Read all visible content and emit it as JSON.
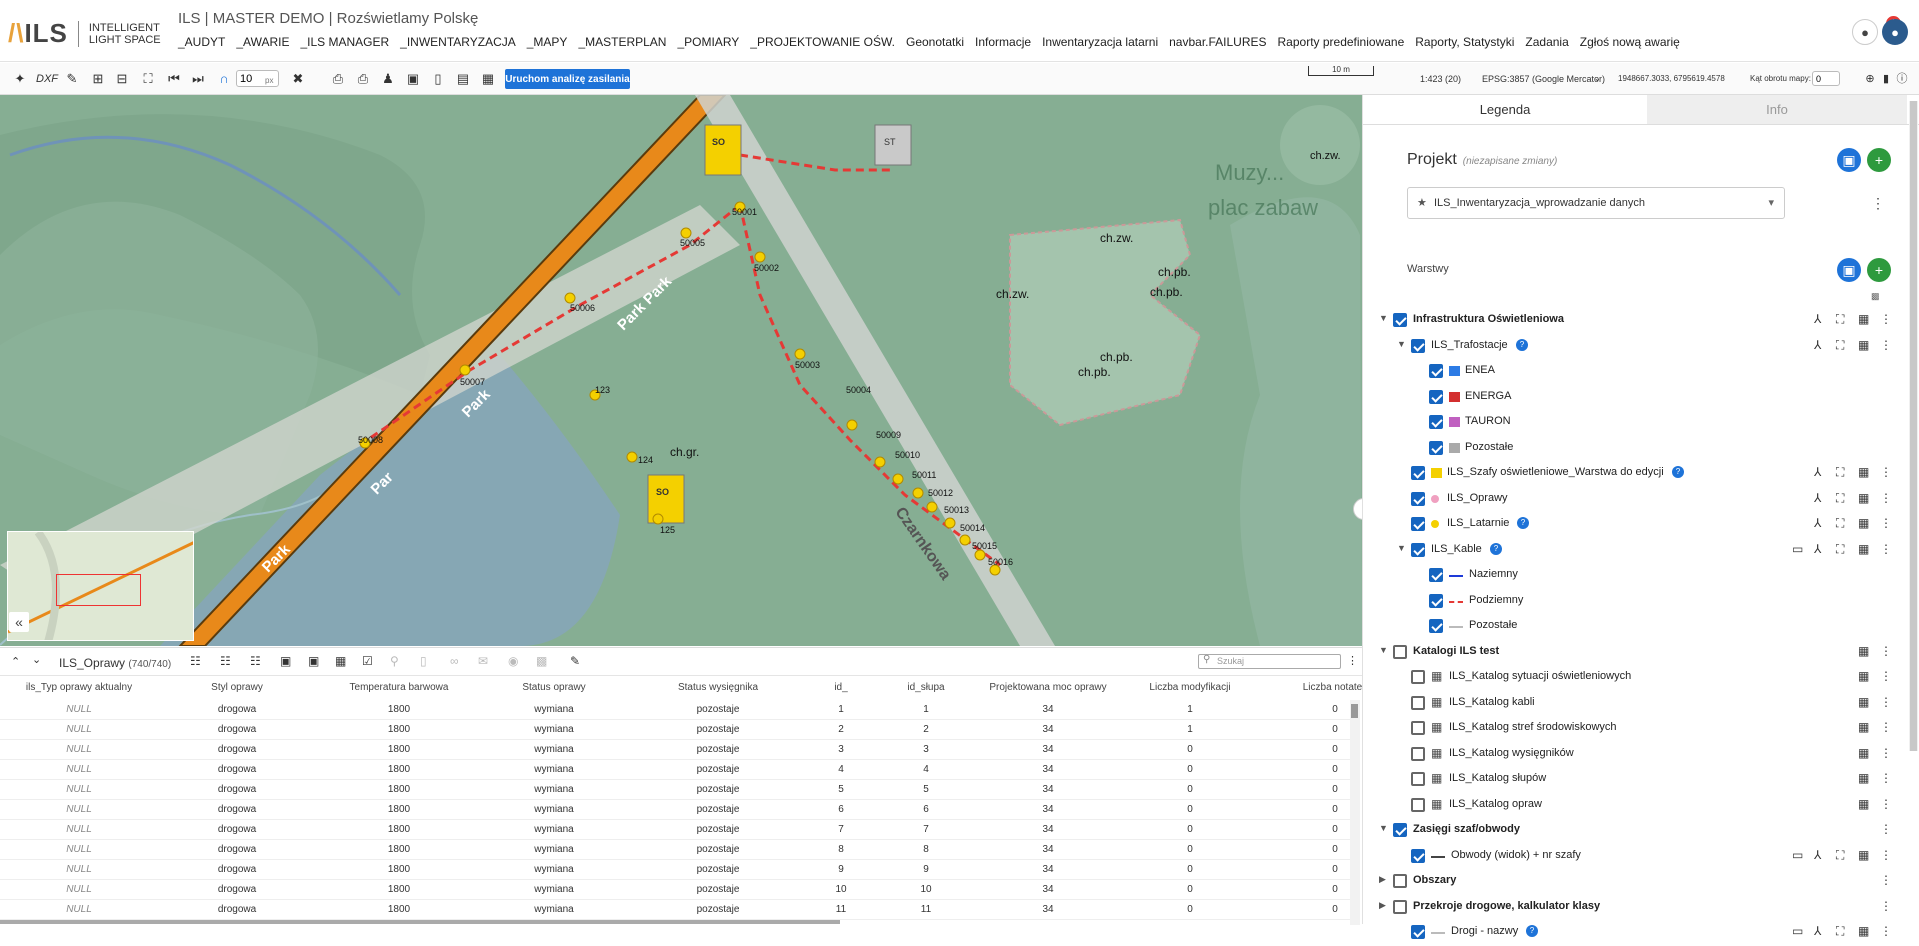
{
  "app": {
    "logo_mark": "ILS",
    "logo_text_1": "INTELLIGENT",
    "logo_text_2": "LIGHT SPACE",
    "title": "ILS | MASTER DEMO | Rozświetlamy Polskę",
    "notification_count": "1"
  },
  "menu": [
    "_AUDYT",
    "_AWARIE",
    "_ILS MANAGER",
    "_INWENTARYZACJA",
    "_MAPY",
    "_MASTERPLAN",
    "_POMIARY",
    "_PROJEKTOWANIE OŚW.",
    "Geonotatki",
    "Informacje",
    "Inwentaryzacja latarni",
    "navbar.FAILURES",
    "Raporty predefiniowane",
    "Raporty, Statystyki",
    "Zadania",
    "Zgłoś nową awarię"
  ],
  "toolbar": {
    "dxf_label": "DXF",
    "tolerance_value": "10",
    "tolerance_unit": "px",
    "run_button": "Uruchom analizę zasilania",
    "scale_bar_label": "10 m",
    "scale": "1:423 (20)",
    "crs": "EPSG:3857 (Google Mercator)",
    "coords": "1948667.3033, 6795619.4578",
    "rotation_label": "Kąt obrotu mapy:",
    "rotation_value": "0"
  },
  "map": {
    "labels": {
      "park1": "Park",
      "park2": "Park Park",
      "park3": "Park",
      "park4": "Par",
      "street": "Czarnkowa",
      "playground1": "Muzy...",
      "playground2": "plac zabaw",
      "chgr": "ch.gr.",
      "chzw1": "ch.zw.",
      "chzw2": "ch.zw.",
      "chzw3": "ch.zw.",
      "chpb1": "ch.pb.",
      "chpb2": "ch.pb.",
      "chpb3": "ch.pb.",
      "chpb4": "ch.pb.",
      "so_label": "SO",
      "st_label": "ST"
    },
    "points": [
      "50001",
      "50002",
      "50003",
      "50004",
      "50005",
      "50006",
      "50007",
      "50008",
      "50009",
      "50010",
      "50011",
      "50012",
      "50013",
      "50014",
      "50015",
      "50016",
      "123",
      "124",
      "125"
    ]
  },
  "table": {
    "layer_name": "ILS_Oprawy",
    "count": "(740/740)",
    "search_placeholder": "Szukaj",
    "columns": [
      "ils_Typ oprawy aktualny",
      "Styl oprawy",
      "Temperatura barwowa",
      "Status oprawy",
      "Status wysięgnika",
      "id_",
      "id_słupa",
      "Projektowana moc oprawy",
      "Liczba modyfikacji",
      "Liczba notatek"
    ],
    "rows": [
      [
        "NULL",
        "drogowa",
        "1800",
        "wymiana",
        "pozostaje",
        "1",
        "1",
        "34",
        "1",
        "0"
      ],
      [
        "NULL",
        "drogowa",
        "1800",
        "wymiana",
        "pozostaje",
        "2",
        "2",
        "34",
        "1",
        "0"
      ],
      [
        "NULL",
        "drogowa",
        "1800",
        "wymiana",
        "pozostaje",
        "3",
        "3",
        "34",
        "0",
        "0"
      ],
      [
        "NULL",
        "drogowa",
        "1800",
        "wymiana",
        "pozostaje",
        "4",
        "4",
        "34",
        "0",
        "0"
      ],
      [
        "NULL",
        "drogowa",
        "1800",
        "wymiana",
        "pozostaje",
        "5",
        "5",
        "34",
        "0",
        "0"
      ],
      [
        "NULL",
        "drogowa",
        "1800",
        "wymiana",
        "pozostaje",
        "6",
        "6",
        "34",
        "0",
        "0"
      ],
      [
        "NULL",
        "drogowa",
        "1800",
        "wymiana",
        "pozostaje",
        "7",
        "7",
        "34",
        "0",
        "0"
      ],
      [
        "NULL",
        "drogowa",
        "1800",
        "wymiana",
        "pozostaje",
        "8",
        "8",
        "34",
        "0",
        "0"
      ],
      [
        "NULL",
        "drogowa",
        "1800",
        "wymiana",
        "pozostaje",
        "9",
        "9",
        "34",
        "0",
        "0"
      ],
      [
        "NULL",
        "drogowa",
        "1800",
        "wymiana",
        "pozostaje",
        "10",
        "10",
        "34",
        "0",
        "0"
      ],
      [
        "NULL",
        "drogowa",
        "1800",
        "wymiana",
        "pozostaje",
        "11",
        "11",
        "34",
        "0",
        "0"
      ]
    ]
  },
  "sidebar": {
    "tab_legend": "Legenda",
    "tab_info": "Info",
    "project_label": "Projekt",
    "project_note": "(niezapisane zmiany)",
    "project_value": "ILS_Inwentaryzacja_wprowadzanie danych",
    "layers_label": "Warstwy",
    "tree": [
      {
        "label": "Infrastruktura Oświetleniowa",
        "checked": true,
        "bold": true
      },
      {
        "label": "ILS_Trafostacje",
        "checked": true
      },
      {
        "label": "ENEA",
        "checked": true
      },
      {
        "label": "ENERGA",
        "checked": true
      },
      {
        "label": "TAURON",
        "checked": true
      },
      {
        "label": "Pozostałe",
        "checked": true
      },
      {
        "label": "ILS_Szafy oświetleniowe_Warstwa do edycji",
        "checked": true
      },
      {
        "label": "ILS_Oprawy",
        "checked": true
      },
      {
        "label": "ILS_Latarnie",
        "checked": true
      },
      {
        "label": "ILS_Kable",
        "checked": true
      },
      {
        "label": "Naziemny",
        "checked": true
      },
      {
        "label": "Podziemny",
        "checked": true
      },
      {
        "label": "Pozostałe",
        "checked": true
      },
      {
        "label": "Katalogi ILS test",
        "checked": false,
        "bold": true
      },
      {
        "label": "ILS_Katalog sytuacji oświetleniowych",
        "checked": false
      },
      {
        "label": "ILS_Katalog kabli",
        "checked": false
      },
      {
        "label": "ILS_Katalog stref środowiskowych",
        "checked": false
      },
      {
        "label": "ILS_Katalog wysięgników",
        "checked": false
      },
      {
        "label": "ILS_Katalog słupów",
        "checked": false
      },
      {
        "label": "ILS_Katalog opraw",
        "checked": false
      },
      {
        "label": "Zasięgi szaf/obwody",
        "checked": true,
        "bold": true
      },
      {
        "label": "Obwody (widok) + nr szafy",
        "checked": true
      },
      {
        "label": "Obszary",
        "checked": false,
        "bold": true
      },
      {
        "label": "Przekroje drogowe, kalkulator klasy",
        "checked": false,
        "bold": true
      },
      {
        "label": "Drogi - nazwy",
        "checked": true
      }
    ]
  },
  "colors": {
    "accent_blue": "#1e73d8",
    "add_green": "#2e9a3e",
    "road_orange": "#e8891a",
    "cable_red": "#e53935",
    "point_yellow": "#f4d000"
  }
}
